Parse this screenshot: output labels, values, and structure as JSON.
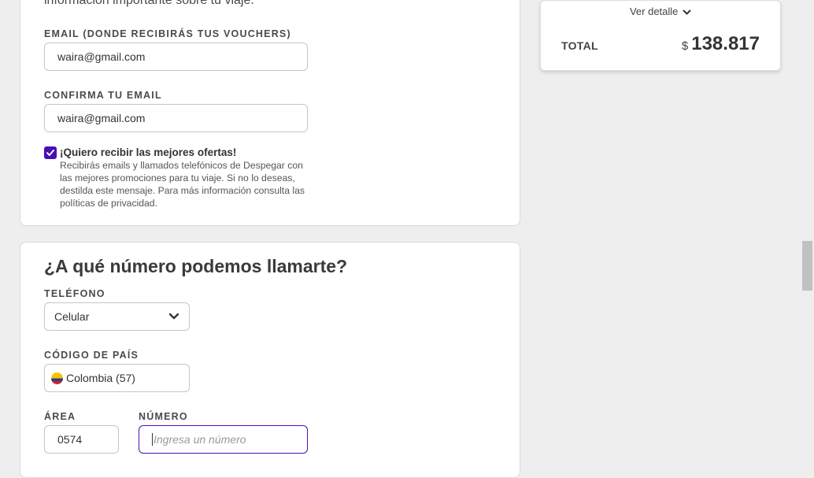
{
  "contact": {
    "intro_text": "información importante sobre tu viaje.",
    "email_label": "EMAIL (DONDE RECIBIRÁS TUS VOUCHERS)",
    "email_value": "waira@gmail.com",
    "confirm_label": "CONFIRMA TU EMAIL",
    "confirm_value": "waira@gmail.com",
    "offers_checked": true,
    "offers_title": "¡Quiero recibir las mejores ofertas!",
    "offers_desc": "Recibirás emails y llamados telefónicos de Despegar con las mejores promociones para tu viaje. Si no lo deseas, destilda este mensaje. Para más información consulta las políticas de privacidad."
  },
  "phone": {
    "title": "¿A qué número podemos llamarte?",
    "phone_label": "TELÉFONO",
    "phone_type": "Celular",
    "country_label": "CÓDIGO DE PAÍS",
    "country_value": "Colombia (57)",
    "area_label": "ÁREA",
    "area_value": "0574",
    "number_label": "NÚMERO",
    "number_placeholder": "Ingresa un número"
  },
  "summary": {
    "ver_detalle": "Ver detalle",
    "total_label": "TOTAL",
    "currency": "$",
    "total_value": "138.817"
  },
  "colors": {
    "accent": "#4b0db5",
    "background": "#eeeeee"
  }
}
